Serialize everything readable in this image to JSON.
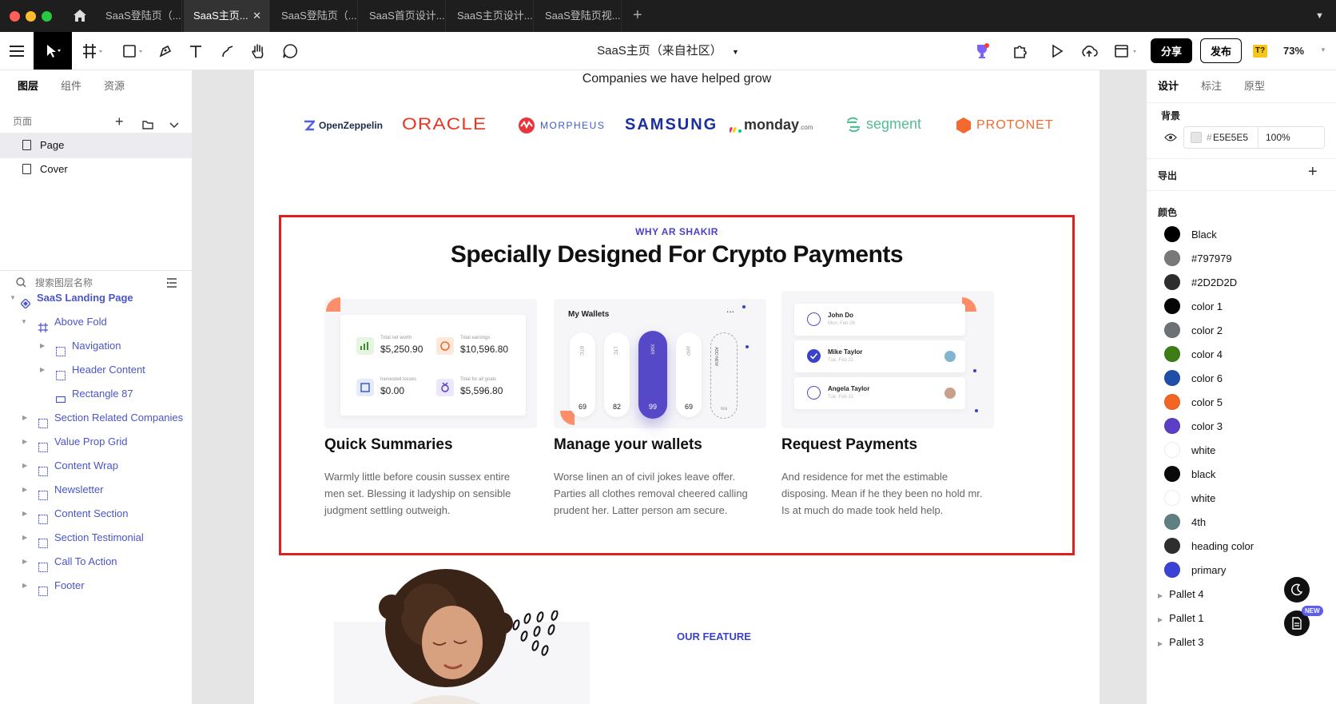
{
  "tabs": [
    "SaaS登陆页（...",
    "SaaS主页...",
    "SaaS登陆页（...",
    "SaaS首页设计...",
    "SaaS主页设计...",
    "SaaS登陆页视..."
  ],
  "active_tab_index": 1,
  "toolbar": {
    "doc_title": "SaaS主页（来自社区）",
    "share": "分享",
    "publish": "发布",
    "badge": "T?",
    "zoom": "73%"
  },
  "left": {
    "tabs": [
      "图层",
      "组件",
      "资源"
    ],
    "pages_header": "页面",
    "pages": [
      "Page",
      "Cover"
    ],
    "search_placeholder": "搜索图层名称",
    "layers": [
      {
        "name": "SaaS Landing Page",
        "bold": true
      },
      {
        "name": "Above Fold"
      },
      {
        "name": "Navigation"
      },
      {
        "name": "Header Content"
      },
      {
        "name": "Rectangle 87"
      },
      {
        "name": "Section Related Companies"
      },
      {
        "name": "Value Prop Grid"
      },
      {
        "name": "Content Wrap"
      },
      {
        "name": "Newsletter"
      },
      {
        "name": "Content Section"
      },
      {
        "name": "Section Testimonial"
      },
      {
        "name": "Call To Action"
      },
      {
        "name": "Footer"
      }
    ]
  },
  "canvas": {
    "companies_title": "Companies we have helped grow",
    "logos": [
      "OpenZeppelin",
      "ORACLE",
      "MORPHEUS",
      "SAMSUNG",
      "monday",
      ".com",
      "segment",
      "PROTONET"
    ],
    "eyebrow": "WHY AR SHAKIR",
    "heading": "Specially Designed For Crypto Payments",
    "card1": {
      "items": [
        {
          "label": "Total net worth",
          "value": "$5,250.90"
        },
        {
          "label": "Total earnings",
          "value": "$10,596.80"
        },
        {
          "label": "harvested losses",
          "value": "$0.00"
        },
        {
          "label": "Total for all goals",
          "value": "$5,596.80"
        }
      ]
    },
    "card2": {
      "title": "My Wallets",
      "more": "...",
      "pills": [
        "BTC",
        "LTC",
        "XMR",
        "XRP",
        "ADD NEW"
      ],
      "values": [
        "69",
        "82",
        "99",
        "69",
        "Wal"
      ]
    },
    "card3": {
      "rows": [
        {
          "name": "John Do",
          "date": "Mon, Feb 28"
        },
        {
          "name": "Mike Taylor",
          "date": "Tue, Feb 21"
        },
        {
          "name": "Angela Taylor",
          "date": "Tue, Feb 21"
        }
      ]
    },
    "features": [
      {
        "title": "Quick Summaries",
        "text": "Warmly little before cousin sussex entire men set. Blessing it ladyship on sensible judgment settling outweigh."
      },
      {
        "title": "Manage your wallets",
        "text": "Worse linen an of civil jokes leave offer. Parties all clothes removal cheered calling prudent her. Latter person am secure."
      },
      {
        "title": "Request Payments",
        "text": "And residence for met the estimable disposing. Mean if he they been no hold mr. Is at much do made took held help."
      }
    ],
    "bottom_eyebrow": "OUR FEATURE"
  },
  "right": {
    "tabs": [
      "设计",
      "标注",
      "原型"
    ],
    "background_label": "背景",
    "background": {
      "hash": "#",
      "hex": "E5E5E5",
      "opacity": "100%"
    },
    "export_label": "导出",
    "colors_label": "颜色",
    "colors": [
      {
        "name": "Black",
        "hex": "#000000"
      },
      {
        "name": "#797979",
        "hex": "#797979"
      },
      {
        "name": "#2D2D2D",
        "hex": "#2D2D2D"
      },
      {
        "name": "color 1",
        "hex": "#050505"
      },
      {
        "name": "color 2",
        "hex": "#6E7276"
      },
      {
        "name": "color 4",
        "hex": "#3C7D16"
      },
      {
        "name": "color 6",
        "hex": "#1F4FA8"
      },
      {
        "name": "color 5",
        "hex": "#F26522"
      },
      {
        "name": "color 3",
        "hex": "#5B3FC4"
      },
      {
        "name": "white",
        "hex": "#FFFFFF"
      },
      {
        "name": "black",
        "hex": "#0A0A0A"
      },
      {
        "name": "white",
        "hex": "#FFFFFF"
      },
      {
        "name": "4th",
        "hex": "#5F7F80"
      },
      {
        "name": "heading color",
        "hex": "#2E2E2E"
      },
      {
        "name": "primary",
        "hex": "#3C42D6"
      }
    ],
    "pallets": [
      "Pallet 4",
      "Pallet 1",
      "Pallet 3"
    ],
    "new_badge": "NEW"
  }
}
